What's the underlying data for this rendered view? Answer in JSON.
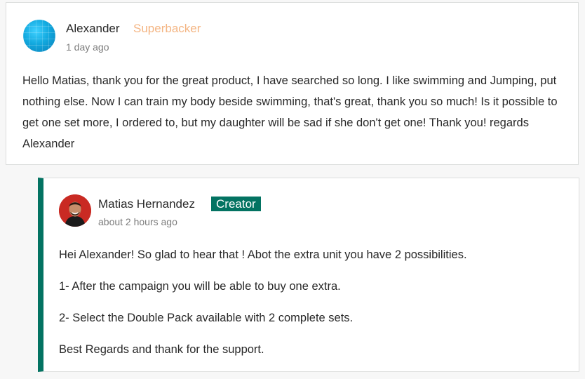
{
  "comment": {
    "author": "Alexander",
    "badge": "Superbacker",
    "time": "1 day ago",
    "avatar_icon": "blue-avatar-icon",
    "body": "Hello Matias, thank you for the great product, I have searched so long. I like swimming and Jumping, put nothing else. Now I can train my body beside swimming, that's great, thank you so much! Is it possible to get one set more, I ordered to, but my daughter will be sad if she don't get one! Thank you! regards Alexander"
  },
  "reply": {
    "author": "Matias Hernandez",
    "badge": "Creator",
    "time": "about 2 hours ago",
    "avatar_icon": "person-avatar-icon",
    "paragraphs": [
      "Hei Alexander! So glad to hear that ! Abot the extra unit you have 2 possibilities.",
      "1- After the campaign you will be able to buy one extra.",
      "2- Select the Double Pack available with 2 complete sets.",
      "Best Regards and thank for the support."
    ]
  },
  "colors": {
    "creator_badge": "#037362",
    "superbacker_badge": "#f4b583",
    "reply_accent": "#037362"
  }
}
